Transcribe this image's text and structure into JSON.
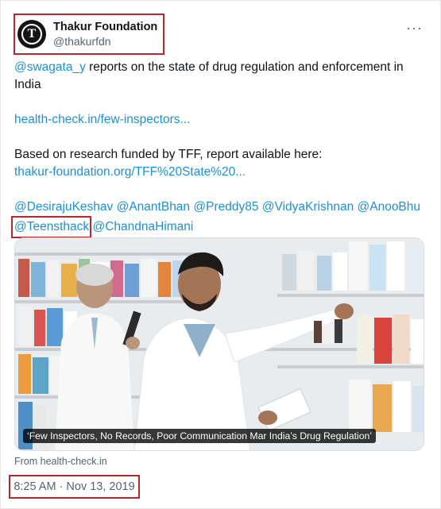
{
  "author": {
    "display_name": "Thakur Foundation",
    "handle": "@thakurfdn",
    "avatar_letter": "T"
  },
  "more_label": "···",
  "tweet": {
    "mention_lead": "@swagata_y",
    "line1_rest": " reports on the state of drug regulation and enforcement in",
    "line2": "India",
    "link1": "health-check.in/few-inspectors...",
    "line_research": "Based on research funded by TFF, report available here:",
    "link2": "thakur-foundation.org/TFF%20State%20...",
    "mentions_row1": [
      "@DesirajuKeshav",
      "@AnantBhan",
      "@Preddy85",
      "@VidyaKrishnan",
      "@AnooBhu"
    ],
    "mention_highlighted": "@Teensthack",
    "mention_last": "@ChandnaHimani"
  },
  "media": {
    "caption": "‘Few Inspectors, No Records, Poor Communication Mar India’s Drug Regulation’",
    "source": "From health-check.in"
  },
  "timestamp": "8:25 AM · Nov 13, 2019",
  "colors": {
    "link": "#1d8fd9",
    "highlight_box": "#b8282c",
    "muted": "#536471"
  }
}
